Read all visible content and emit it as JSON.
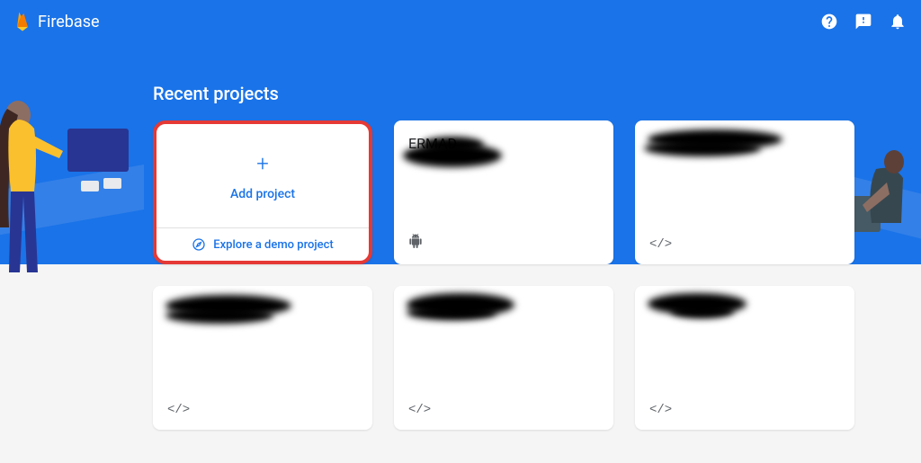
{
  "header": {
    "brand": "Firebase"
  },
  "section": {
    "title": "Recent projects"
  },
  "addCard": {
    "label": "Add project",
    "demoLink": "Explore a demo project"
  },
  "projects": [
    {
      "name": "ERMAD",
      "platform": "android"
    },
    {
      "name": "",
      "platform": "web"
    },
    {
      "name": "",
      "platform": "web"
    },
    {
      "name": "",
      "platform": "web"
    },
    {
      "name": "",
      "platform": "web"
    }
  ]
}
